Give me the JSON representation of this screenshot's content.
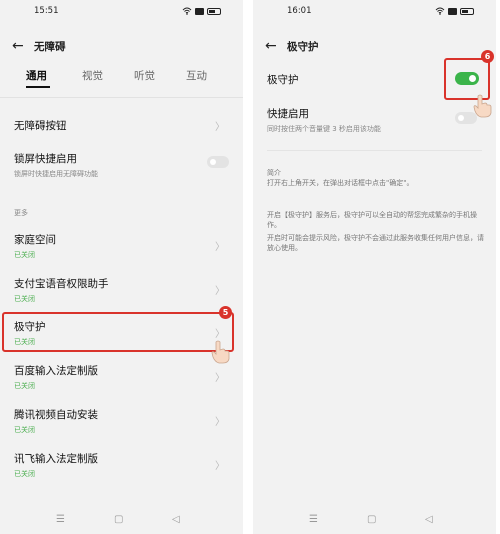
{
  "left": {
    "status": {
      "time": "15:51"
    },
    "header": {
      "title": "无障碍"
    },
    "tabs": [
      "通用",
      "视觉",
      "听觉",
      "互动"
    ],
    "items": [
      {
        "label": "无障碍按钮"
      },
      {
        "label": "锁屏快捷启用",
        "sub": "锁屏时快捷启用无障碍功能"
      }
    ],
    "section_more": "更多",
    "more_items": [
      {
        "label": "家庭空间",
        "status": "已关闭"
      },
      {
        "label": "支付宝语音权限助手",
        "status": "已关闭"
      },
      {
        "label": "极守护",
        "status": "已关闭"
      },
      {
        "label": "百度输入法定制版",
        "status": "已关闭"
      },
      {
        "label": "腾讯视频自动安装",
        "status": "已关闭"
      },
      {
        "label": "讯飞输入法定制版",
        "status": "已关闭"
      }
    ],
    "step_badge": "5"
  },
  "right": {
    "status": {
      "time": "16:01"
    },
    "header": {
      "title": "极守护"
    },
    "main_toggle": {
      "label": "极守护",
      "state": "on"
    },
    "shortcut": {
      "label": "快捷启用",
      "sub": "同时按住两个音量键 3 秒启用该功能",
      "state": "off"
    },
    "intro_title": "简介",
    "intro_text": "打开右上角开关，在弹出对话框中点击\"确定\"。",
    "para1": "开启【极守护】服务后，极守护可以全自动的帮您完成繁杂的手机操作。",
    "para2": "开启时可能会提示风险，极守护不会通过此服务收集任何用户信息，请放心使用。",
    "step_badge": "6"
  },
  "nav": {
    "menu": "☰",
    "home": "▢",
    "back": "◁"
  },
  "colors": {
    "highlight": "#d9332b",
    "toggle_on": "#3bb44a",
    "status_green": "#4caf50"
  }
}
